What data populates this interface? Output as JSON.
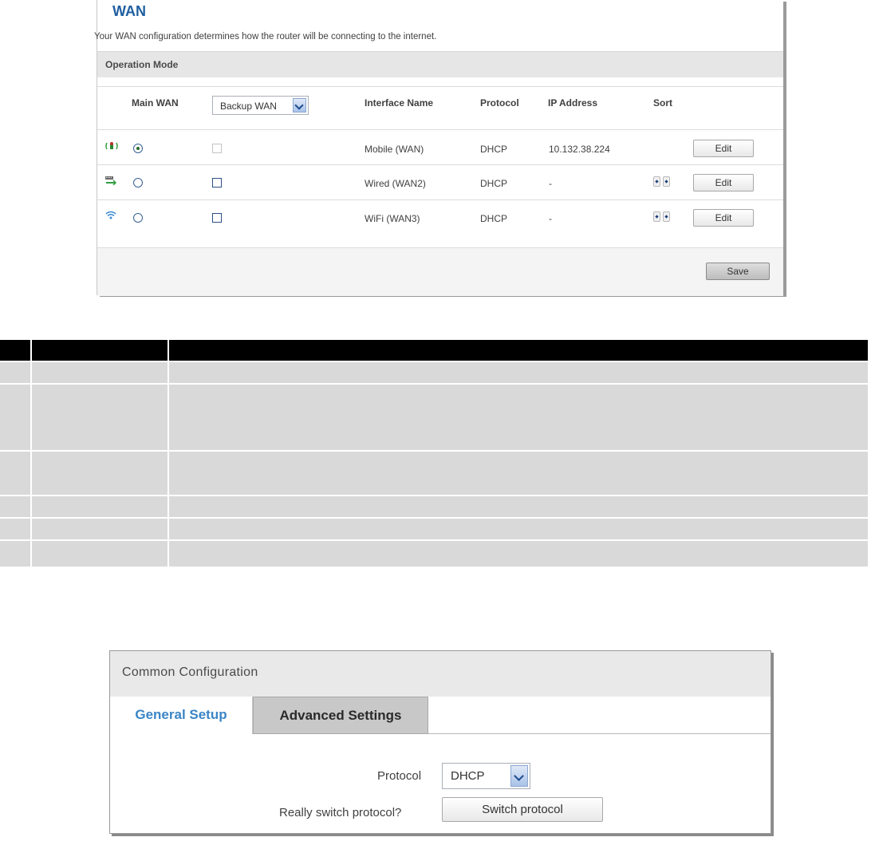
{
  "wan": {
    "title": "WAN",
    "description": "Your WAN configuration determines how the router will be connecting to the internet.",
    "section": "Operation Mode",
    "headers": {
      "main_wan": "Main WAN",
      "backup_wan": "Backup WAN",
      "interface_name": "Interface Name",
      "protocol": "Protocol",
      "ip_address": "IP Address",
      "sort": "Sort"
    },
    "rows": [
      {
        "icon": "mobile-signal-icon",
        "main_selected": true,
        "backup_enabled": false,
        "interface": "Mobile (WAN)",
        "protocol": "DHCP",
        "ip": "10.132.38.224",
        "edit": "Edit"
      },
      {
        "icon": "wired-ethernet-icon",
        "main_selected": false,
        "backup_enabled": true,
        "interface": "Wired (WAN2)",
        "protocol": "DHCP",
        "ip": "-",
        "edit": "Edit"
      },
      {
        "icon": "wifi-icon",
        "main_selected": false,
        "backup_enabled": true,
        "interface": "WiFi (WAN3)",
        "protocol": "DHCP",
        "ip": "-",
        "edit": "Edit"
      }
    ],
    "save": "Save"
  },
  "common": {
    "title": "Common Configuration",
    "tabs": [
      "General Setup",
      "Advanced Settings"
    ],
    "active_tab": "General Setup",
    "protocol_label": "Protocol",
    "protocol_value": "DHCP",
    "switch_label": "Really switch protocol?",
    "switch_button": "Switch protocol"
  },
  "colors": {
    "title_blue": "#1f5fa0",
    "active_tab": "#3a85c6",
    "table_header": "#000000",
    "table_band": "#d9d9d9"
  }
}
